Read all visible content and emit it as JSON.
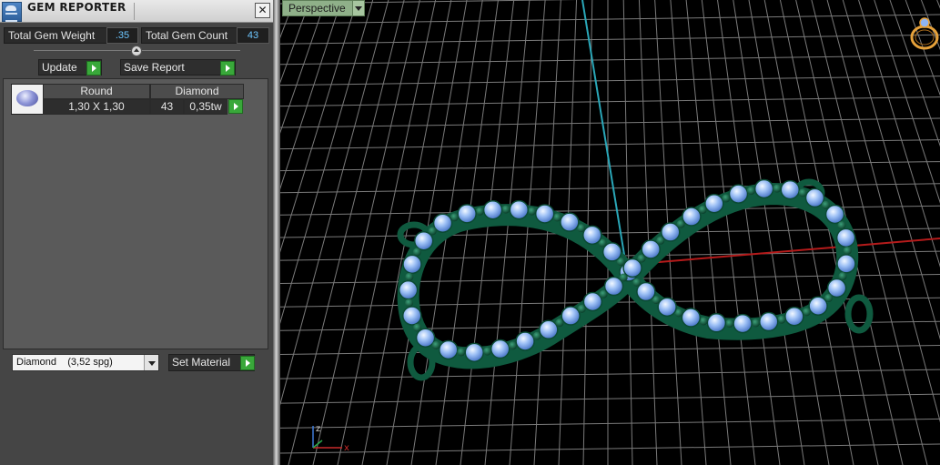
{
  "window": {
    "title": "GEM REPORTER",
    "close_label": "✕"
  },
  "totals": {
    "weight_label": "Total Gem Weight",
    "weight_value": ".35",
    "count_label": "Total Gem Count",
    "count_value": "43"
  },
  "actions": {
    "update_label": "Update",
    "save_report_label": "Save Report"
  },
  "gem_table": {
    "header": [
      "Round",
      "Diamond"
    ],
    "row": {
      "size": "1,30 X 1,30",
      "count": "43",
      "weight": "0,35tw"
    }
  },
  "material": {
    "selected": "Diamond    (3,52 spg)",
    "set_label": "Set Material"
  },
  "viewport": {
    "view_name": "Perspective",
    "axis_x": "x",
    "axis_z": "z"
  },
  "colors": {
    "panel_bg": "#454545",
    "value_text": "#6cc6ff",
    "play_green": "#39a83a",
    "grid_line": "#7a7a7a",
    "axis_red": "#b51b1b",
    "axis_cyan": "#2aa7b8",
    "metal_green": "#0f5a3f",
    "gem_blue": "#8fb4f2"
  },
  "icons": [
    "gem-reporter-icon",
    "close-icon",
    "play-icon",
    "dropdown-arrow-icon",
    "ring-icon",
    "axis-gizmo-icon"
  ]
}
